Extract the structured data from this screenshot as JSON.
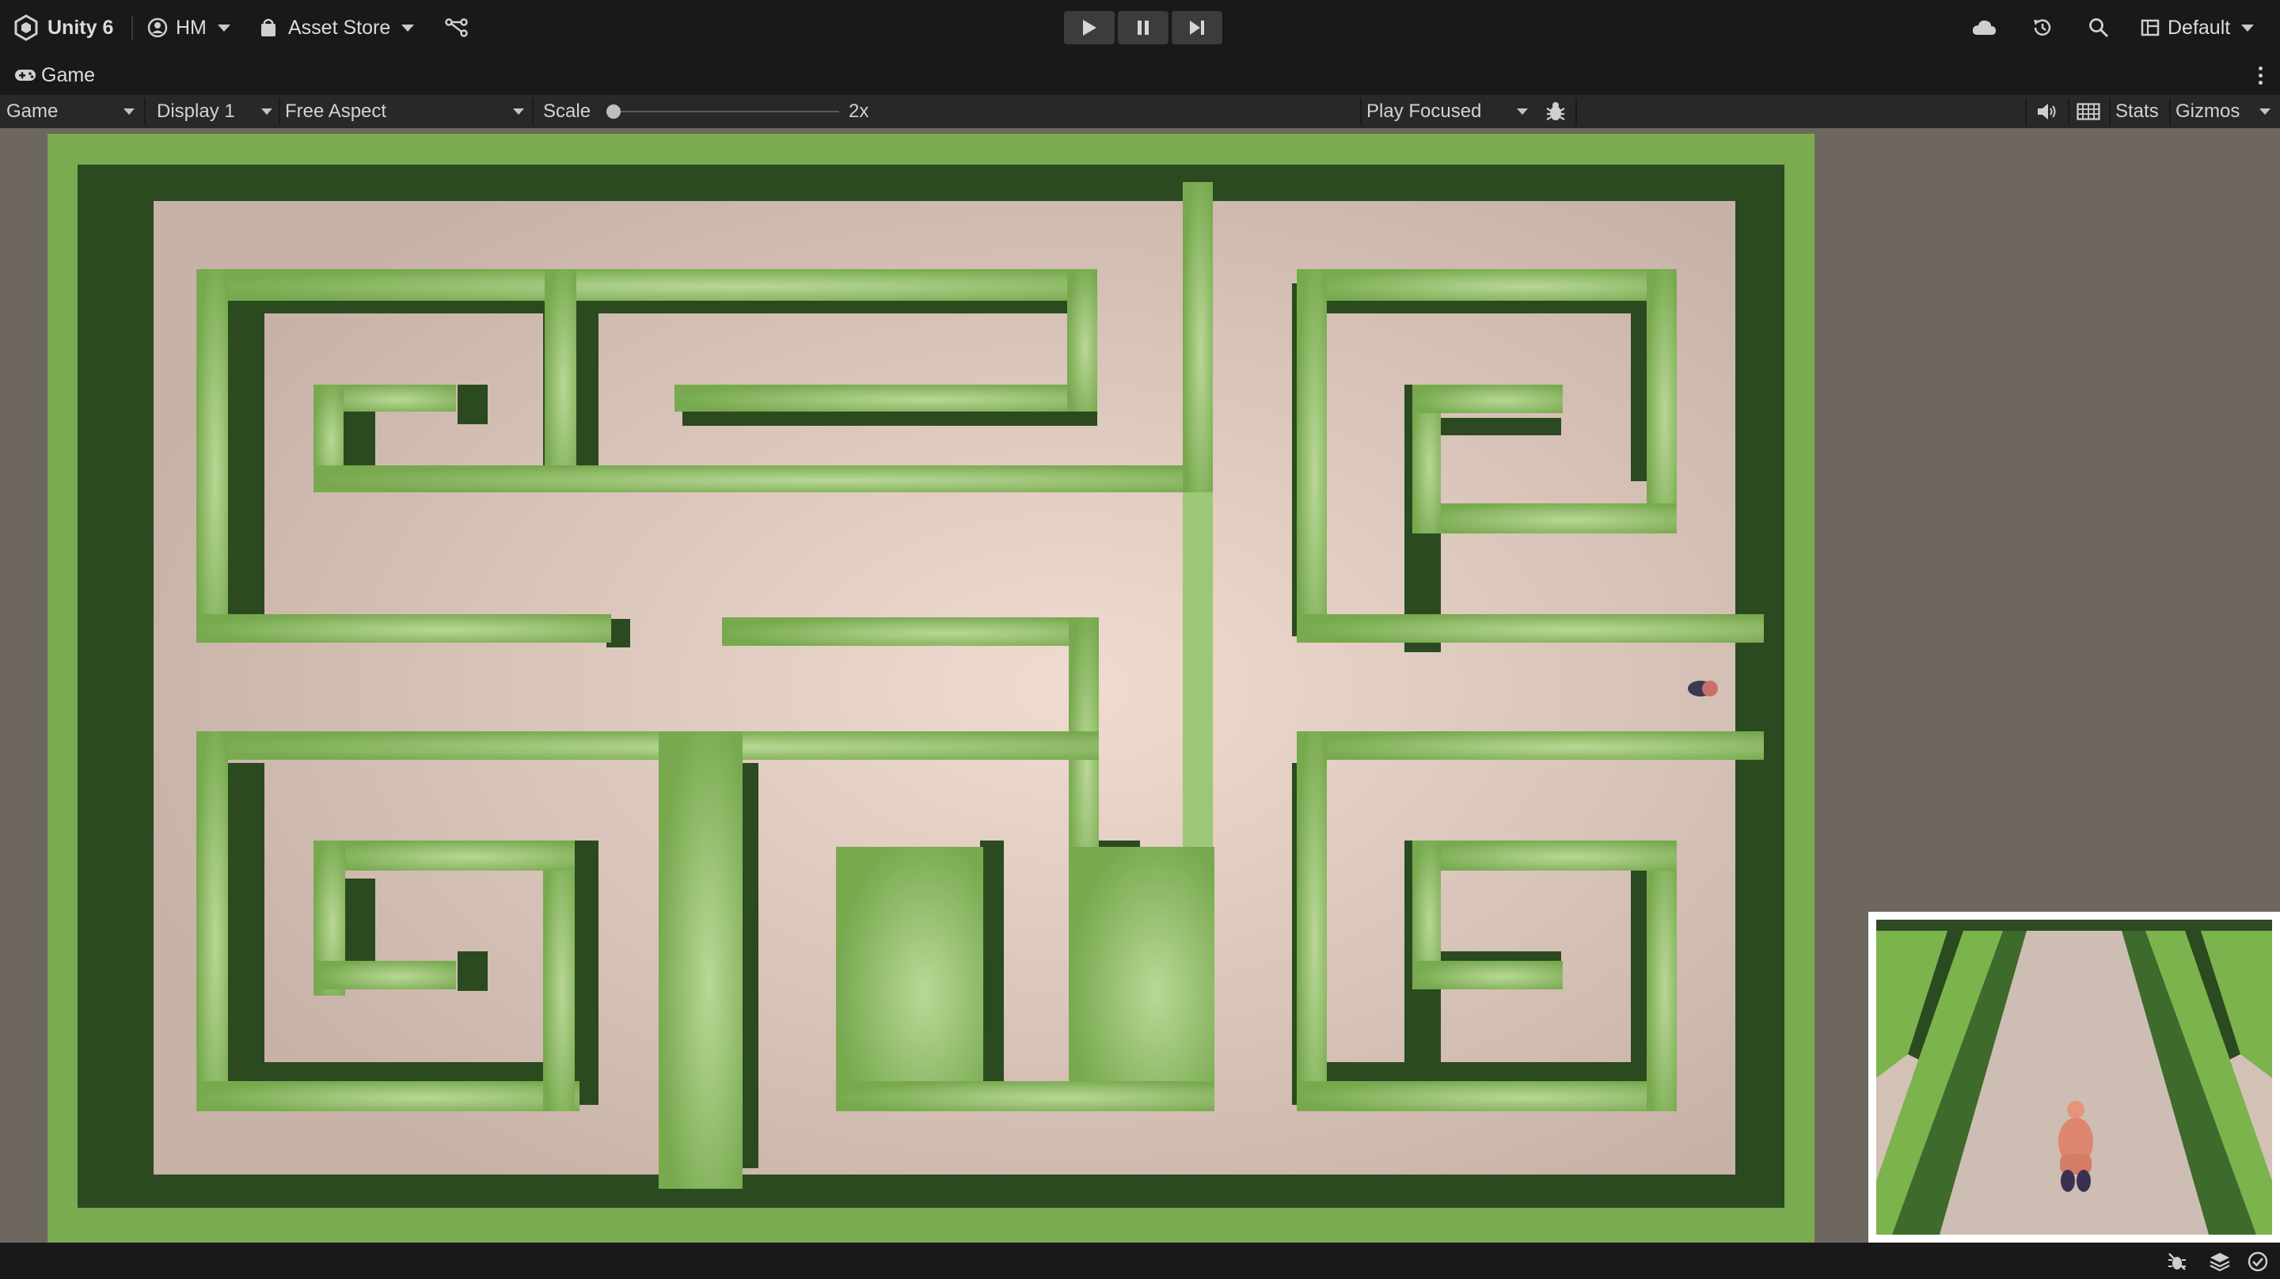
{
  "toolbar": {
    "app_name": "Unity 6",
    "account": "HM",
    "asset_store": "Asset Store",
    "layout": "Default",
    "icons": [
      "unity-logo-icon",
      "account-icon",
      "asset-store-icon",
      "version-control-icon",
      "play-icon",
      "pause-icon",
      "step-icon",
      "cloud-icon",
      "history-icon",
      "search-icon",
      "layout-icon"
    ]
  },
  "tab": {
    "label": "Game",
    "icon": "gamepad-icon"
  },
  "game_toolbar": {
    "view_type": "Game",
    "display": "Display 1",
    "aspect": "Free Aspect",
    "scale_label": "Scale",
    "scale_value": "2x",
    "scale_slider_fraction": 0.0,
    "play_mode": "Play Focused",
    "stats": "Stats",
    "gizmos": "Gizmos",
    "icons": [
      "bug-icon",
      "audio-icon",
      "grid-icon"
    ]
  },
  "scene": {
    "description_colors": {
      "floor": "#d9c3b8",
      "wall_top": "#7fb057",
      "wall_side": "#2b4a1f",
      "background": "#6e6760"
    }
  },
  "status_bar": {
    "icons": [
      "debug-off-icon",
      "layers-icon",
      "check-icon"
    ]
  },
  "colors": {
    "toolbar_bg": "#191919",
    "gamebar_bg": "#282828",
    "minimap_border": "#ffffff"
  }
}
